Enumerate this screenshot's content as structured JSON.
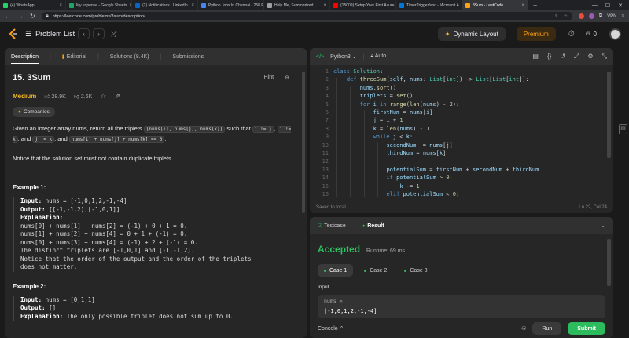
{
  "browser": {
    "tabs": [
      {
        "label": "(4) WhatsApp",
        "color": "#25d366",
        "active": false
      },
      {
        "label": "My expense - Google Sheets",
        "color": "#1fa463",
        "active": false
      },
      {
        "label": "(2) Notifications | LinkedIn",
        "color": "#0a66c2",
        "active": false
      },
      {
        "label": "Python Jobs In Chennai - 258 P",
        "color": "#4285f4",
        "active": false
      },
      {
        "label": "Help Me, Summarized",
        "color": "#9aa0a6",
        "active": false
      },
      {
        "label": "(15009) Setup Your First Azure",
        "color": "#ff0000",
        "active": false
      },
      {
        "label": "TimerTriggerfunc - Microsoft A",
        "color": "#0078d4",
        "active": false
      },
      {
        "label": "3Sum - LeetCode",
        "color": "#ffa116",
        "active": true
      }
    ],
    "new_tab": "+",
    "url": "https://leetcode.com/problems/3sum/description/",
    "vpn_label": "VPN"
  },
  "header": {
    "problem_list_label": "Problem List",
    "dynamic_layout_label": "Dynamic Layout",
    "premium_label": "Premium",
    "streak_count": "0"
  },
  "left_panel": {
    "tabs": [
      {
        "label": "Description",
        "active": true
      },
      {
        "label": "Editorial",
        "active": false
      },
      {
        "label": "Solutions (8.4K)",
        "active": false
      },
      {
        "label": "Submissions",
        "active": false
      }
    ],
    "title": "15. 3Sum",
    "hint_label": "Hint",
    "difficulty": "Medium",
    "likes": "28.9K",
    "dislikes": "2.6K",
    "companies_label": "Companies",
    "statement": {
      "t1": "Given an integer array nums, return all the triplets ",
      "c1": "[nums[i], nums[j], nums[k]]",
      "t2": " such that ",
      "c2": "i != j",
      "t3": ", ",
      "c3": "i != k",
      "t4": ", and ",
      "c4": "j != k",
      "t5": ", and ",
      "c5": "nums[i] + nums[j] + nums[k] == 0",
      "t6": "."
    },
    "notice": "Notice that the solution set must not contain duplicate triplets.",
    "example1": {
      "heading": "Example 1:",
      "input_label": "Input:",
      "input_value": " nums = [-1,0,1,2,-1,-4]",
      "output_label": "Output:",
      "output_value": " [[-1,-1,2],[-1,0,1]]",
      "explanation_label": "Explanation:",
      "lines": [
        "nums[0] + nums[1] + nums[2] = (-1) + 0 + 1 = 0.",
        "nums[1] + nums[2] + nums[4] = 0 + 1 + (-1) = 0.",
        "nums[0] + nums[3] + nums[4] = (-1) + 2 + (-1) = 0.",
        "The distinct triplets are [-1,0,1] and [-1,-1,2].",
        "Notice that the order of the output and the order of the triplets",
        "does not matter."
      ]
    },
    "example2": {
      "heading": "Example 2:",
      "input_label": "Input:",
      "input_value": " nums = [0,1,1]",
      "output_label": "Output:",
      "output_value": " []",
      "explanation_label": "Explanation:",
      "explanation_value": " The only possible triplet does not sum up to 0."
    }
  },
  "code_panel": {
    "language": "Python3",
    "auto_label": "Auto",
    "line_numbers": [
      "1",
      "2",
      "3",
      "4",
      "5",
      "6",
      "7",
      "8",
      "9",
      "10",
      "11",
      "12",
      "13",
      "14",
      "15",
      "16"
    ],
    "saved_label": "Saved to local",
    "cursor_pos": "Ln 22, Col 24"
  },
  "result_panel": {
    "tabs": [
      {
        "label": "Testcase",
        "active": false
      },
      {
        "label": "Result",
        "active": true
      }
    ],
    "status": "Accepted",
    "runtime": "Runtime: 69 ms",
    "cases": [
      {
        "label": "Case 1",
        "active": true
      },
      {
        "label": "Case 2",
        "active": false
      },
      {
        "label": "Case 3",
        "active": false
      }
    ],
    "input_label": "Input",
    "input_var": "nums =",
    "input_value": "[-1,0,1,2,-1,-4]",
    "console_label": "Console",
    "run_label": "Run",
    "submit_label": "Submit"
  },
  "colors": {
    "accepted": "#2cbb5d",
    "medium": "#ffc01e",
    "premium": "#ffa116"
  }
}
